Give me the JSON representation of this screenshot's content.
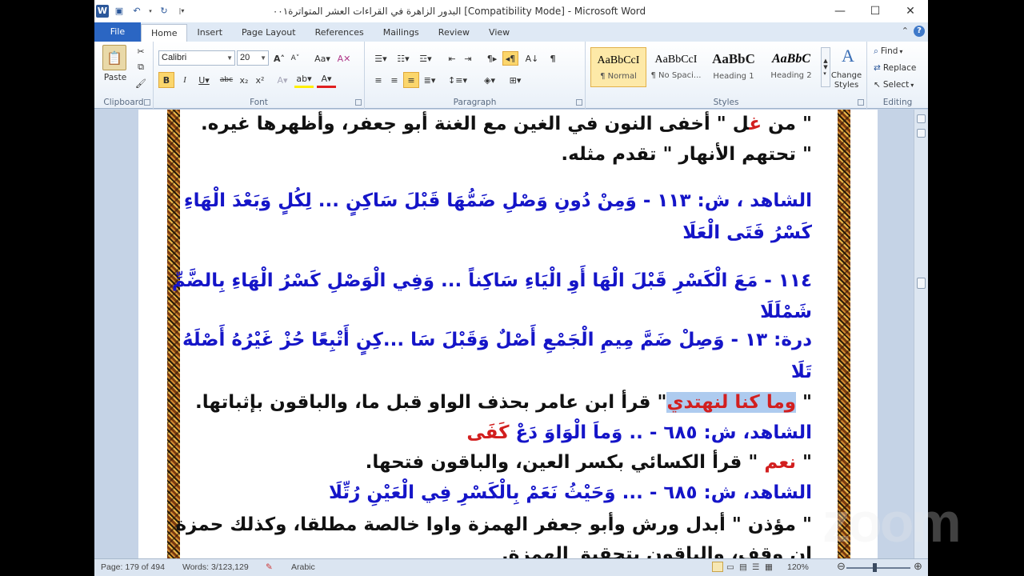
{
  "window": {
    "title": "البدور الزاهرة في القراءات العشر المتواترة٠٠١ [Compatibility Mode]  -  Microsoft Word",
    "controls": {
      "minimize": "—",
      "maximize": "☐",
      "close": "✕"
    }
  },
  "tabs": [
    "File",
    "Home",
    "Insert",
    "Page Layout",
    "References",
    "Mailings",
    "Review",
    "View"
  ],
  "ribbon": {
    "clipboard": {
      "label": "Clipboard",
      "paste": "Paste"
    },
    "font": {
      "label": "Font",
      "name": "Calibri",
      "size": "20"
    },
    "paragraph": {
      "label": "Paragraph"
    },
    "styles": {
      "label": "Styles",
      "items": [
        {
          "sample": "AaBbCcI",
          "name": "¶ Normal"
        },
        {
          "sample": "AaBbCcI",
          "name": "¶ No Spaci..."
        },
        {
          "sample": "AaBbC",
          "name": "Heading 1"
        },
        {
          "sample": "AaBbC",
          "name": "Heading 2"
        }
      ],
      "change": "Change Styles"
    },
    "editing": {
      "label": "Editing",
      "find": "Find",
      "replace": "Replace",
      "select": "Select"
    }
  },
  "document": {
    "lines": [
      {
        "pre": "\" من ",
        "red": "غ",
        "post": "ل \" أخفى النون في الغين مع الغنة أبو جعفر، وأظهرها غيره."
      },
      {
        "text": "\" تحتهم الأنهار \" تقدم مثله."
      },
      {
        "text": "الشاهد ، ش: ١١٣ - وَمِنْ دُونِ وَصْلِ ضَمُّهَا قَبْلَ سَاكِنٍ ... لِكُلٍ وَبَعْدَ الْهَاءِ"
      },
      {
        "text": "كَسْرُ فَتَى الْعَلَا"
      },
      {
        "text": "١١٤ - مَعَ الْكَسْرِ قَبْلَ الْهَا أَوِ الْيَاءِ سَاكِناً ... وَفِي الْوَصْلِ كَسْرُ الْهَاءِ بِالضَّمِّ"
      },
      {
        "text": "شَمْلَلَا"
      },
      {
        "text": "درة: ١٣ - وَصِلْ ضَمَّ مِيمِ الْجَمْعِ أَصْلٌ وَقَبْلَ سَا ...كِنٍ أَتْبِعًا حُزْ غَيْرُهُ أَصْلَهُ"
      },
      {
        "text": "تَلَا"
      },
      {
        "highlight": "وما كنا لنهتدي",
        "post": "\" قرأ ابن عامر بحذف الواو قبل ما، والباقون بإثباتها."
      },
      {
        "pre": "الشاهد، ش: ٦٨٥ - .. وَماَ الْوَاوَ دَعْ ",
        "red": "كَفَى"
      },
      {
        "red": "نعم",
        "post": "\" قرأ الكسائي بكسر العين، والباقون فتحها."
      },
      {
        "text": "الشاهد، ش: ٦٨٥ - ... وَحَيْثُ نَعَمْ بِالْكَسْرِ فِي الْعَيْنِ رُتِّلَا"
      },
      {
        "text": "\" مؤذن \" أبدل ورش وأبو جعفر الهمزة واوا خالصة مطلقا، وكذلك حمزة"
      },
      {
        "text": "إن وقف، والباقون بتحقيق الهمزة."
      }
    ]
  },
  "status": {
    "page": "Page: 179 of 494",
    "words": "Words: 3/123,129",
    "language": "Arabic",
    "zoom": "120%"
  },
  "watermark": "zoom"
}
